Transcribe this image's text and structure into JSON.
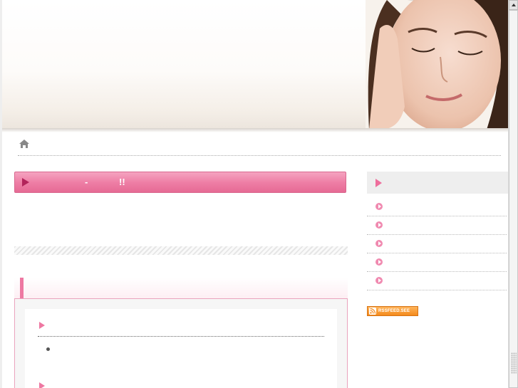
{
  "header": {
    "image": "woman-face-photo"
  },
  "breadcrumb": {
    "icon": "home-icon"
  },
  "main": {
    "title": {
      "dash": "-",
      "excl": "!!"
    }
  },
  "sidebar": {
    "items": [
      {},
      {},
      {},
      {},
      {}
    ]
  },
  "rss": {
    "label": "RSSFEED.SEE"
  },
  "colors": {
    "accent": "#ee78a2",
    "title_bar": "#ee7fa6",
    "sidebar_head": "#eeeeee",
    "rss": "#f48a1c"
  }
}
